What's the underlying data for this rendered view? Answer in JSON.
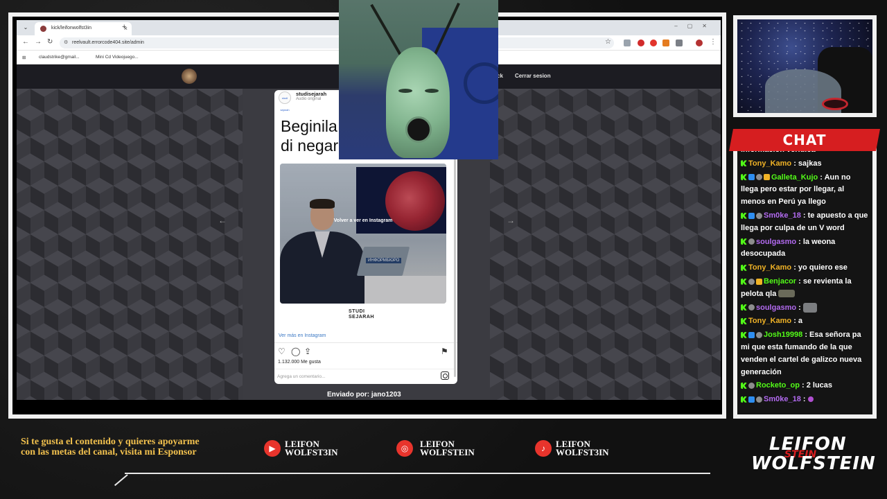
{
  "browser": {
    "tab_title": "kick/leifonwolfst3in",
    "url": "reelvault.errorcode404.site/admin",
    "bookmarks": [
      "claudstrike@gmail...",
      "Mini Cd Videojuego..."
    ]
  },
  "site": {
    "nav_links": [
      "ck",
      "Cerrar sesion"
    ]
  },
  "instagram": {
    "username": "studisejarah",
    "subtitle": "Audio original",
    "avatar_text": "studi sejarah",
    "caption": "Beginila\ndi negar",
    "video_watch_again": "Volver a ver en Instagram",
    "video_badge": "ИНФОРМБЮРО",
    "brand_text": "STUDI\nSEJARAH",
    "view_more": "Ver más en Instagram",
    "likes": "1.132.000 Me gusta",
    "comment_placeholder": "Agrega un comentario...",
    "sent_by": "Enviado por: jano1203"
  },
  "chat": {
    "title": "CHAT",
    "messages": [
      {
        "badges": [],
        "user": "",
        "color": "#ffffff",
        "text": "información verídica"
      },
      {
        "badges": [
          "kick"
        ],
        "user": "Tony_Kamo",
        "color": "#f1b326",
        "text": ": sajkas"
      },
      {
        "badges": [
          "kick",
          "blue",
          "gray",
          "gold"
        ],
        "user": "Galleta_Kujo",
        "color": "#53fc18",
        "text": ": Aun no llega pero estar por llegar, al menos en Perú ya llego"
      },
      {
        "badges": [
          "kick",
          "blue",
          "gray"
        ],
        "user": "Sm0ke_18",
        "color": "#b26af0",
        "text": ": te apuesto a que llega por culpa de un V word"
      },
      {
        "badges": [
          "kick",
          "gray"
        ],
        "user": "soulgasmo",
        "color": "#b26af0",
        "text": ": la weona desocupada"
      },
      {
        "badges": [
          "kick"
        ],
        "user": "Tony_Kamo",
        "color": "#f1b326",
        "text": ": yo quiero ese"
      },
      {
        "badges": [
          "kick",
          "gray",
          "gold"
        ],
        "user": "Benjacor",
        "color": "#53fc18",
        "text": ": se revienta la pelota qla",
        "emote": "e1"
      },
      {
        "badges": [
          "kick",
          "gray"
        ],
        "user": "soulgasmo",
        "color": "#b26af0",
        "text": ":",
        "emote": "e2"
      },
      {
        "badges": [
          "kick"
        ],
        "user": "Tony_Kamo",
        "color": "#f1b326",
        "text": ": a"
      },
      {
        "badges": [
          "kick",
          "blue",
          "gray"
        ],
        "user": "Josh19998",
        "color": "#53fc18",
        "text": ": Esa señora pa mi que esta fumando de la que venden el cartel de galizco nueva generación"
      },
      {
        "badges": [
          "kick",
          "gray"
        ],
        "user": "Rocketo_op",
        "color": "#53fc18",
        "text": ": 2 lucas"
      },
      {
        "badges": [
          "kick",
          "blue",
          "gray"
        ],
        "user": "Sm0ke_18",
        "color": "#b26af0",
        "text": ":",
        "emote": "e3"
      }
    ]
  },
  "footer": {
    "promo_text": "Si te gusta el contenido y quieres apoyarme con las metas del canal, visita mi Esponsor",
    "socials": [
      {
        "icon": "youtube-icon",
        "glyph": "▶",
        "label": "LEIFON\nWOLFST3IN"
      },
      {
        "icon": "instagram-icon",
        "glyph": "◎",
        "label": "LEIFON\nWOLFSTEIN"
      },
      {
        "icon": "tiktok-icon",
        "glyph": "♪",
        "label": "LEIFON\nWOLFST3IN"
      }
    ],
    "brand_top": "LEIFON",
    "brand_bottom": "WOLFSTEIN",
    "brand_overlay": "STEIN"
  },
  "colors": {
    "accent": "#d61e20",
    "kick_green": "#53fc18",
    "footer_gold": "#f2c14e"
  }
}
